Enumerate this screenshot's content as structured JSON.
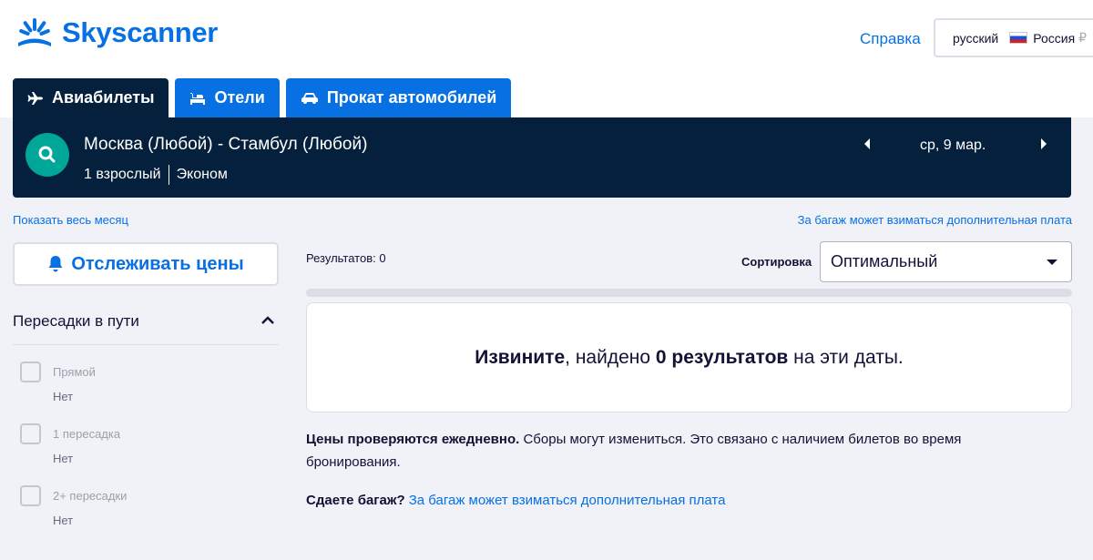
{
  "header": {
    "logo_text": "Skyscanner",
    "help_link": "Справка",
    "locale": {
      "language": "русский",
      "country": "Россия",
      "extra": "₽"
    }
  },
  "tabs": [
    {
      "label": "Авиабилеты",
      "icon": "airplane-icon",
      "active": true
    },
    {
      "label": "Отели",
      "icon": "bed-icon",
      "active": false
    },
    {
      "label": "Прокат автомобилей",
      "icon": "car-icon",
      "active": false
    }
  ],
  "search": {
    "route": "Москва (Любой) - Стамбул (Любой)",
    "passengers": "1 взрослый",
    "cabin": "Эконом",
    "date": "ср, 9 мар."
  },
  "links": {
    "show_month": "Показать весь месяц",
    "baggage_fee": "За багаж может взиматься дополнительная плата"
  },
  "sidebar": {
    "track_prices": "Отслеживать цены",
    "stops_title": "Пересадки в пути",
    "stops": [
      {
        "label": "Прямой",
        "price": "Нет",
        "checked": false
      },
      {
        "label": "1 пересадка",
        "price": "Нет",
        "checked": false
      },
      {
        "label": "2+ пересадки",
        "price": "Нет",
        "checked": false
      }
    ]
  },
  "results": {
    "count_text": "Результатов: 0",
    "sort_label": "Сортировка",
    "sort_value": "Оптимальный",
    "no_results": {
      "part1": "Извините",
      "part2": ", найдено ",
      "part3": "0 результатов",
      "part4": " на эти даты."
    },
    "notice_bold": "Цены проверяются ежедневно.",
    "notice_text": " Сборы могут измениться. Это связано с наличием билетов во время бронирования.",
    "baggage_question": "Сдаете багаж?",
    "baggage_link": "За багаж может взиматься дополнительная плата"
  },
  "colors": {
    "brand_blue": "#0770e3",
    "navy": "#05203c",
    "teal": "#00a698",
    "background": "#f1f2f8"
  }
}
